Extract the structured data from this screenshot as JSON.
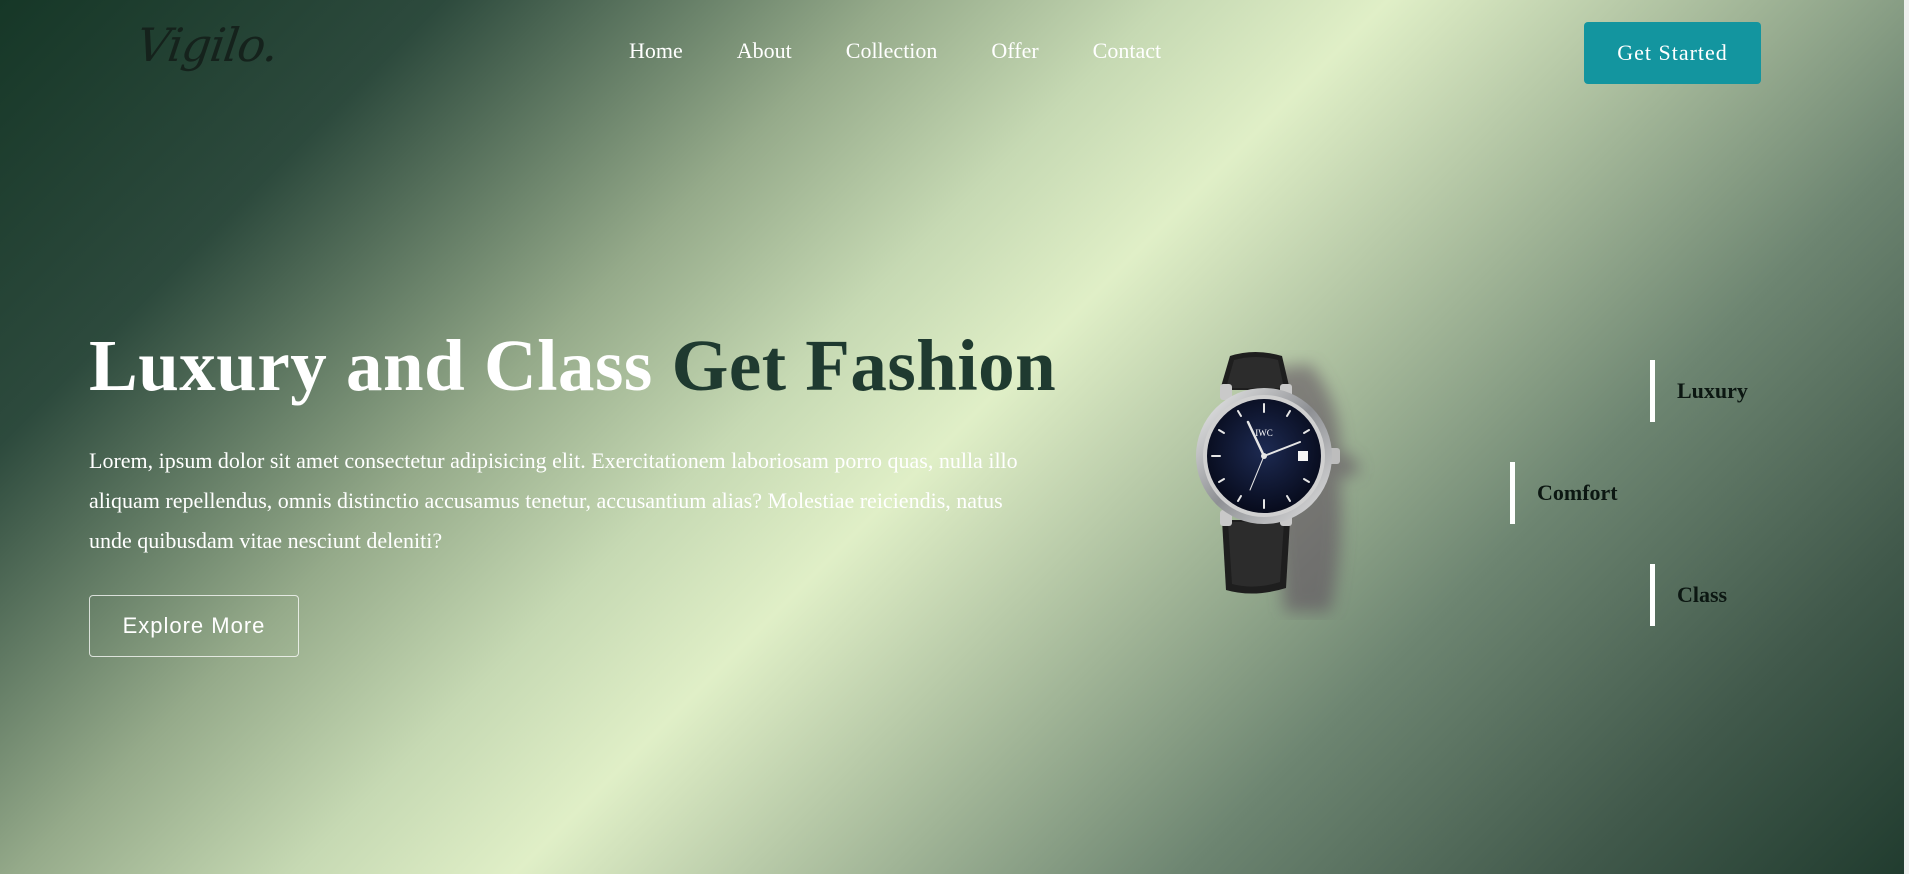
{
  "brand": {
    "logo_text": "Vigilo."
  },
  "nav": {
    "items": [
      {
        "label": "Home"
      },
      {
        "label": "About"
      },
      {
        "label": "Collection"
      },
      {
        "label": "Offer"
      },
      {
        "label": "Contact"
      }
    ],
    "cta_label": "Get Started"
  },
  "hero": {
    "title_light": "Luxury and Class",
    "title_dark": "Get Fashion",
    "body": "Lorem, ipsum dolor sit amet consectetur adipisicing elit. Exercitationem laboriosam porro quas, nulla illo aliquam repellendus, omnis distinctio accusamus tenetur, accusantium alias? Molestiae reiciendis, natus unde quibusdam vitae nesciunt deleniti?",
    "explore_label": "Explore More",
    "watch_brand": "IWC"
  },
  "features": [
    {
      "label": "Luxury"
    },
    {
      "label": "Comfort"
    },
    {
      "label": "Class"
    }
  ],
  "colors": {
    "accent": "#13959f",
    "headline_dark": "#1f3a30",
    "gradient_light": "#e0efc7",
    "gradient_dark": "#163727"
  }
}
